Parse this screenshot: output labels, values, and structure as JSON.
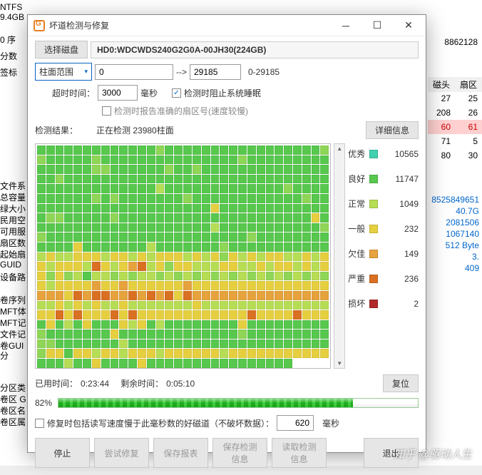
{
  "backdrop": {
    "ntfs": "NTFS",
    "size": "9.4GB",
    "seq": "0 序",
    "fen": "分数",
    "label": "签标",
    "bignum": "8862128",
    "head_cols": [
      "磁头",
      "扇区"
    ],
    "rows": [
      [
        "27",
        "25"
      ],
      [
        "208",
        "26"
      ],
      [
        "60",
        "61"
      ],
      [
        "71",
        "5"
      ],
      [
        "80",
        "30"
      ]
    ],
    "left": [
      "文件系",
      "总容量",
      "绿大小",
      "民用空",
      "可用服",
      "扇区数",
      "起始扇",
      "GUID",
      "设备路",
      "",
      "卷序列",
      "MFT体",
      "MFT记",
      "文件记",
      "卷GUI"
    ],
    "anal": "分",
    "bottom": [
      "分区类",
      "卷区 G",
      "卷区名",
      "卷区属"
    ],
    "blue": [
      "8525849651",
      "40.7G",
      "2081506",
      "1067140",
      "512 Byte",
      "",
      "",
      "",
      "3.",
      "",
      "",
      "409"
    ]
  },
  "win": {
    "title": "坏道检测与修复",
    "select_disk": "选择磁盘",
    "disk": "HD0:WDCWDS240G2G0A-00JH30(224GB)",
    "range_mode": "柱面范围",
    "range_from": "0",
    "arrow": "-->",
    "range_to": "29185",
    "range_full": "0-29185",
    "timeout_lbl": "超时时间：",
    "timeout_val": "3000",
    "ms": "毫秒",
    "cb1": "检测时阻止系统睡眠",
    "cb2": "检测时报告准确的扇区号(速度较慢)",
    "result_lbl": "检测结果：",
    "result_val": "正在检测 23980柱面",
    "detail": "详细信息",
    "legend": [
      {
        "label": "优秀",
        "color": "#3fd1b0",
        "count": "10565"
      },
      {
        "label": "良好",
        "color": "#57c84d",
        "count": "11747"
      },
      {
        "label": "正常",
        "color": "#b7dd55",
        "count": "1049"
      },
      {
        "label": "一般",
        "color": "#e6cf3f",
        "count": "232"
      },
      {
        "label": "欠佳",
        "color": "#e6a23c",
        "count": "149"
      },
      {
        "label": "严重",
        "color": "#d97022",
        "count": "236"
      },
      {
        "label": "损坏",
        "color": "#b02a2a",
        "count": "2"
      }
    ],
    "elapsed_lbl": "已用时间：",
    "elapsed": "0:23:44",
    "remain_lbl": "剩余时间：",
    "remain": "0:05:10",
    "reset": "复位",
    "pct": "82%",
    "pct_num": 82,
    "repair_note": "修复时包括读写速度慢于此毫秒数的好磁道（不破坏数据）：",
    "repair_val": "620",
    "ms2": "毫秒",
    "btns": {
      "stop": "停止",
      "try": "尝试修复",
      "save_report": "保存报表",
      "save_detect": "保存检测信息",
      "load_detect": "读取检测信息",
      "exit": "退出"
    }
  },
  "watermark": "知乎 @驱动人生",
  "grid_palette": {
    "0": "#3fd1b0",
    "1": "#57c84d",
    "2": "#8fd657",
    "3": "#b7dd55",
    "4": "#e6cf3f",
    "5": "#e6a23c",
    "6": "#d97022",
    "7": "#b02a2a",
    "8": "#ffffff"
  },
  "grid_rows": [
    "11111111111112111111111111111112",
    "21111121111111111111112111111111",
    "11111122111111211211111111111111",
    "11211111111111111111111111111111",
    "11111111111113111111111111121111",
    "11111121211111112111111111111211",
    "11111111111111111114111111111111",
    "12211111211111111111111111111141",
    "11111111111111111113111111111112",
    "21111111111111111111111211111111",
    "11114111111131111111211111111111",
    "34334443443434443434243434433434",
    "43444364345634244333443343443434",
    "42423133232332323232323232323232",
    "43444454454444445444444444444444",
    "55546566556565646555555555555555",
    "33434343343333333433333333333333",
    "44646444646444444444444644446444",
    "14131411143413111111114111111111",
    "21111111411111111111112111111111",
    "22111111131111111111111111111111",
    "24414434434443444444344444444444",
    "11131141111411111111111111118888",
    "88888888888888888888888888888888"
  ]
}
